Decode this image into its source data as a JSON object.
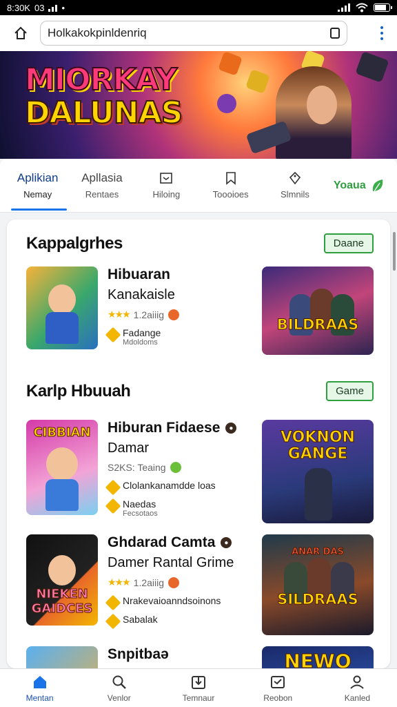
{
  "status": {
    "time": "8:30K",
    "carrier": "03"
  },
  "browser": {
    "url": "Holkakokpinldenriq"
  },
  "banner": {
    "title_line1": "MIORKAY",
    "title_line2": "DALUNAS"
  },
  "categories": [
    {
      "label": "Aplikian",
      "sub": "Nemay",
      "active": true
    },
    {
      "label": "Apllasia",
      "sub": "Rentaes",
      "icon": ""
    },
    {
      "label": "",
      "sub": "Hiloing",
      "icon": "box-icon"
    },
    {
      "label": "",
      "sub": "Toooioes",
      "icon": "bookmark-icon"
    },
    {
      "label": "",
      "sub": "Slmnils",
      "icon": "tag-icon"
    },
    {
      "label": "Yoaua",
      "icon": "leaf-icon",
      "green": true
    }
  ],
  "sections": [
    {
      "title": "Kappalgrhes",
      "button": "Daane"
    },
    {
      "title": "Karlp Hbuuah",
      "button": "Game"
    }
  ],
  "apps": [
    {
      "name": "Hibuaran",
      "sub": "Kanakaisle",
      "rating": "1.2aiiig",
      "tag1": "Fadange",
      "tag2": "Mdoldoms",
      "thumb_title": "",
      "poster_title": "BILDRAAS"
    },
    {
      "name": "Hiburan Fidaese",
      "sub": "Damar",
      "rating": "S2KS: Teaing",
      "tag1": "Clolankanamdde loas",
      "tag2": "",
      "tag3": "Naedas",
      "tag4": "Fecsotaos",
      "thumb_title": "CIBBIAN",
      "poster_title": "VOKNON GANGE"
    },
    {
      "name": "Ghdarad Camta",
      "sub": "Damer Rantal Grime",
      "rating": "1.2aiiig",
      "tag1": "Nrakevaioanndsoinons",
      "tag2": "Sabalak",
      "thumb_title": "NIEKEN GAIDCES",
      "poster_title": "SILDRAAS",
      "poster_top": "ANAR DAS"
    },
    {
      "name": "Snpitbaə",
      "sub": "",
      "thumb_title": "",
      "poster_title": "NEWO"
    }
  ],
  "bottom_nav": [
    {
      "label": "Mentan",
      "icon": "home-icon",
      "active": true
    },
    {
      "label": "Venlor",
      "icon": "search-icon"
    },
    {
      "label": "Temnaur",
      "icon": "download-icon"
    },
    {
      "label": "Reobon",
      "icon": "inbox-icon"
    },
    {
      "label": "Kanled",
      "icon": "profile-icon"
    }
  ],
  "colors": {
    "accent": "#1a73e8",
    "green": "#2e9e3e",
    "star": "#f2b600"
  }
}
